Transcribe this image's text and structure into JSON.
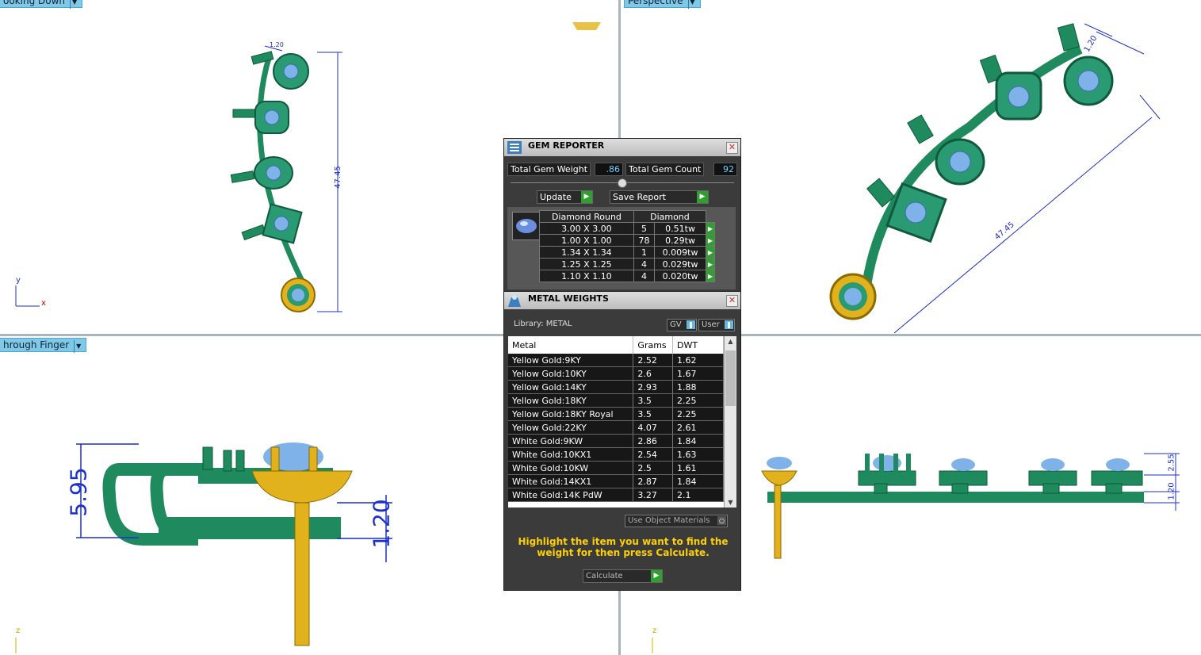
{
  "viewports": {
    "top_left": {
      "tab": "ooking Down"
    },
    "top_right": {
      "tab": "Perspective"
    },
    "bottom_left": {
      "tab": "hrough Finger"
    }
  },
  "dimensions": {
    "top_left_height": "47.45",
    "top_left_small": "1.20",
    "top_right_length": "47.45",
    "top_right_small": "1.20",
    "bottom_left_height": "5.95",
    "bottom_left_small": "1.20",
    "bottom_right_top": "2.55",
    "bottom_right_bottom": "1.20"
  },
  "axes": {
    "y": "y",
    "x": "x",
    "z": "z"
  },
  "gem_reporter": {
    "title": "GEM REPORTER",
    "total_gem_weight_label": "Total Gem Weight",
    "total_gem_weight_value": ".86",
    "total_gem_count_label": "Total Gem Count",
    "total_gem_count_value": "92",
    "update_label": "Update",
    "save_report_label": "Save Report",
    "table": {
      "col1": "Diamond Round",
      "col2": "Diamond",
      "rows": [
        {
          "size": "3.00 X 3.00",
          "count": "5",
          "weight": "0.51tw"
        },
        {
          "size": "1.00 X 1.00",
          "count": "78",
          "weight": "0.29tw"
        },
        {
          "size": "1.34 X 1.34",
          "count": "1",
          "weight": "0.009tw"
        },
        {
          "size": "1.25 X 1.25",
          "count": "4",
          "weight": "0.029tw"
        },
        {
          "size": "1.10 X 1.10",
          "count": "4",
          "weight": "0.020tw"
        }
      ]
    }
  },
  "metal_weights": {
    "title": "METAL WEIGHTS",
    "library": "Library: METAL",
    "gv_label": "GV",
    "user_label": "User",
    "headers": {
      "metal": "Metal",
      "grams": "Grams",
      "dwt": "DWT"
    },
    "rows": [
      {
        "metal": "Yellow Gold:9KY",
        "grams": "2.52",
        "dwt": "1.62"
      },
      {
        "metal": "Yellow Gold:10KY",
        "grams": "2.6",
        "dwt": "1.67"
      },
      {
        "metal": "Yellow Gold:14KY",
        "grams": "2.93",
        "dwt": "1.88"
      },
      {
        "metal": "Yellow Gold:18KY",
        "grams": "3.5",
        "dwt": "2.25"
      },
      {
        "metal": "Yellow Gold:18KY Royal",
        "grams": "3.5",
        "dwt": "2.25"
      },
      {
        "metal": "Yellow Gold:22KY",
        "grams": "4.07",
        "dwt": "2.61"
      },
      {
        "metal": "White Gold:9KW",
        "grams": "2.86",
        "dwt": "1.84"
      },
      {
        "metal": "White Gold:10KX1",
        "grams": "2.54",
        "dwt": "1.63"
      },
      {
        "metal": "White Gold:10KW",
        "grams": "2.5",
        "dwt": "1.61"
      },
      {
        "metal": "White Gold:14KX1",
        "grams": "2.87",
        "dwt": "1.84"
      },
      {
        "metal": "White Gold:14K PdW",
        "grams": "3.27",
        "dwt": "2.1"
      }
    ],
    "use_object_materials": "Use Object Materials",
    "hint": "Highlight the item you want to find the weight for then press Calculate.",
    "calculate_label": "Calculate"
  },
  "colors": {
    "metal_green": "#1f8a5e",
    "gold": "#e2b21c",
    "gem_blue": "#7fb2e8",
    "dim_blue": "#1a2fd0"
  }
}
